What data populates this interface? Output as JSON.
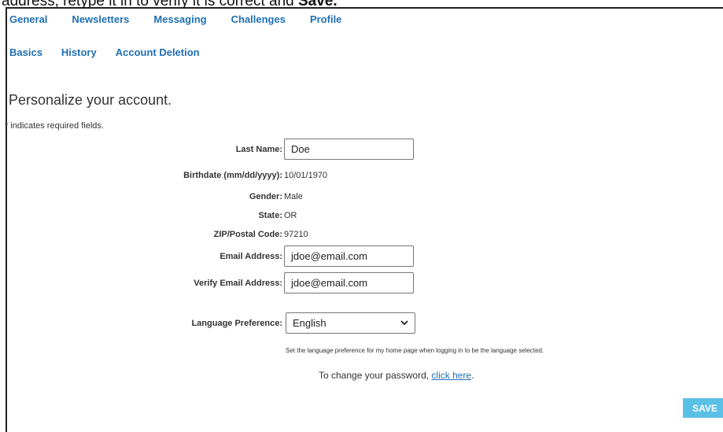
{
  "caption": {
    "prefix": "address, retype it in to verify it is correct and ",
    "emphasis": "Save."
  },
  "nav_primary": [
    "General",
    "Newsletters",
    "Messaging",
    "Challenges",
    "Profile"
  ],
  "nav_secondary": [
    "Basics",
    "History",
    "Account Deletion"
  ],
  "page": {
    "heading": "Personalize your account.",
    "required_note": "* indicates required fields."
  },
  "form": {
    "last_name": {
      "label": "Last Name:",
      "value": "Doe"
    },
    "birthdate": {
      "label": "Birthdate (mm/dd/yyyy):",
      "value": "10/01/1970"
    },
    "gender": {
      "label": "Gender:",
      "value": "Male"
    },
    "state": {
      "label": "State:",
      "value": "OR"
    },
    "zip": {
      "label": "ZIP/Postal Code:",
      "value": "97210"
    },
    "email": {
      "label": "Email Address:",
      "value": "jdoe@email.com"
    },
    "verify_email": {
      "label": "Verify Email Address:",
      "value": "jdoe@email.com"
    },
    "language": {
      "label": "Language Preference:",
      "selected": "English",
      "note": "Set the language preference for my home page when logging in to be the language selected."
    }
  },
  "password": {
    "prefix": "To change your password, ",
    "link": "click here",
    "suffix": "."
  },
  "save_label": "SAVE",
  "colors": {
    "link": "#1f6fb2",
    "save_button": "#5bc0e6"
  }
}
